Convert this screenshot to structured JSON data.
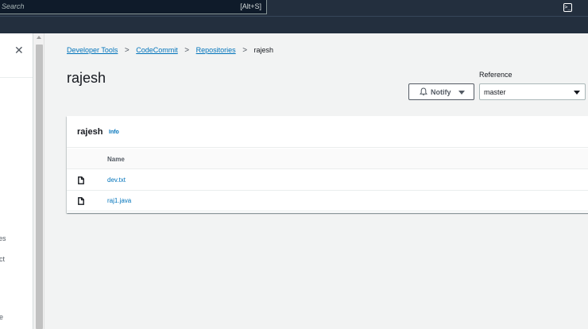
{
  "nav": {
    "search_placeholder": "Search",
    "search_shortcut": "[Alt+S]",
    "cloudshell_glyph": ">_"
  },
  "drawer": {
    "close_glyph": "✕",
    "partial_items": [
      "es",
      "ct",
      "e"
    ]
  },
  "breadcrumb": {
    "items": [
      "Developer Tools",
      "CodeCommit",
      "Repositories"
    ],
    "separator": ">",
    "current": "rajesh"
  },
  "page": {
    "title": "rajesh"
  },
  "notify": {
    "label": "Notify"
  },
  "reference": {
    "label": "Reference",
    "selected": "master"
  },
  "files_panel": {
    "title": "rajesh",
    "info_label": "Info",
    "column_name": "Name",
    "files": [
      {
        "name": "dev.txt",
        "icon": "file-icon"
      },
      {
        "name": "raj1.java",
        "icon": "file-icon"
      }
    ]
  },
  "colors": {
    "nav_bg": "#232f3e",
    "link": "#0073bb",
    "page_bg": "#f2f3f3"
  }
}
